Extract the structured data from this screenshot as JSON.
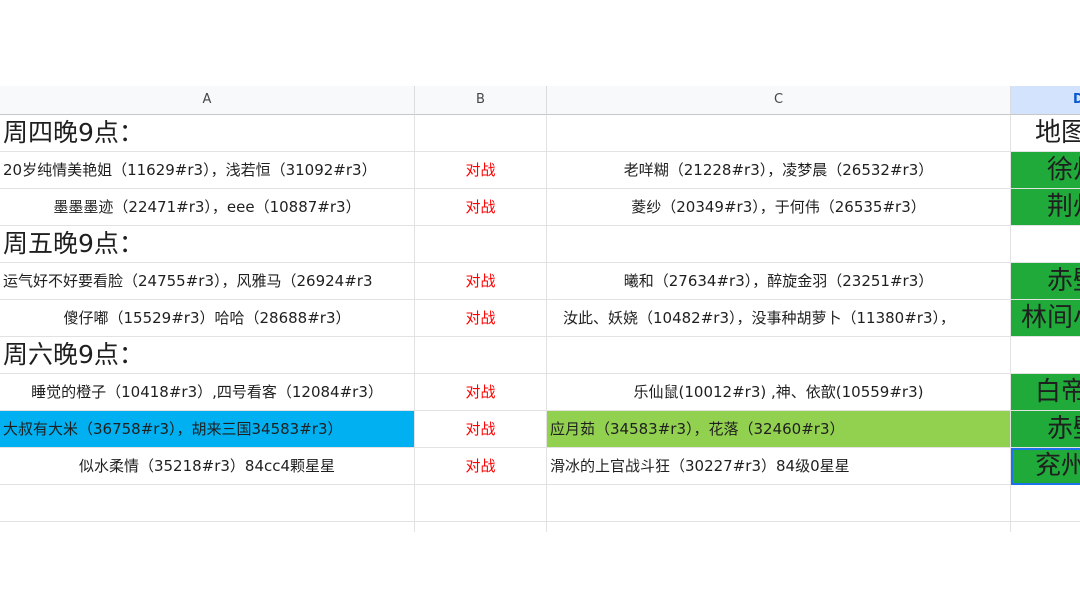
{
  "columns": [
    "A",
    "B",
    "C",
    "D"
  ],
  "rows": [
    {
      "a": "周四晚9点：",
      "b": "",
      "c": "",
      "d": "地图"
    },
    {
      "a": "20岁纯情美艳姐（11629#r3），浅若恒（31092#r3）",
      "b": "对战",
      "c": "老咩糊（21228#r3），凌梦晨（26532#r3）",
      "d": "徐州"
    },
    {
      "a": "墨墨墨迹（22471#r3），eee（10887#r3）",
      "b": "对战",
      "c": "菱纱（20349#r3），于何伟（26535#r3）",
      "d": "荆州"
    },
    {
      "a": "周五晚9点：",
      "b": "",
      "c": "",
      "d": ""
    },
    {
      "a": "运气好不好要看脸（24755#r3），风雅马（26924#r3",
      "b": "对战",
      "c": "曦和（27634#r3），醉旋金羽（23251#r3）",
      "d": "赤壁"
    },
    {
      "a": "傻仔嘟（15529#r3）哈哈（28688#r3）",
      "b": "对战",
      "c": "汝此、妖娆（10482#r3），没事种胡萝卜（11380#r3），",
      "d": "林间小"
    },
    {
      "a": "周六晚9点：",
      "b": "",
      "c": "",
      "d": ""
    },
    {
      "a": "睡觉的橙子（10418#r3）,四号看客（12084#r3）",
      "b": "对战",
      "c": "乐仙鼠(10012#r3) ,神、依歆(10559#r3)",
      "d": "白帝"
    },
    {
      "a": "大叔有大米（36758#r3），胡来三国34583#r3）",
      "b": "对战",
      "c": "应月茹（34583#r3），花落（32460#r3）",
      "d": "赤壁"
    },
    {
      "a": "似水柔情（35218#r3）84cc4颗星星",
      "b": "对战",
      "c": "滑冰的上官战斗狂（30227#r3）84级0星星",
      "d": "兖州"
    },
    {
      "a": "",
      "b": "",
      "c": "",
      "d": ""
    },
    {
      "a": "",
      "b": "",
      "c": "",
      "d": ""
    }
  ]
}
